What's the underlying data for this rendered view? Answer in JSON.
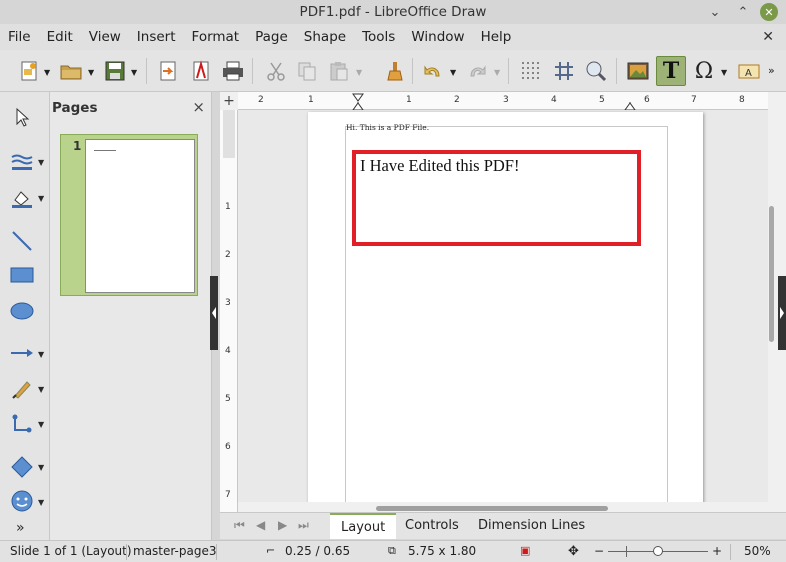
{
  "window": {
    "title": "PDF1.pdf - LibreOffice Draw"
  },
  "menu": [
    "File",
    "Edit",
    "View",
    "Insert",
    "Format",
    "Page",
    "Shape",
    "Tools",
    "Window",
    "Help"
  ],
  "toolbar": {
    "icons": [
      "new-document-icon",
      "open-folder-icon",
      "save-icon",
      "export-icon",
      "export-pdf-icon",
      "print-icon",
      "cut-icon",
      "copy-icon",
      "paste-icon",
      "clone-formatting-icon",
      "undo-icon",
      "redo-icon",
      "grid-icon",
      "helplines-icon",
      "zoom-icon",
      "image-icon",
      "text-icon",
      "special-character-icon",
      "fontwork-icon"
    ]
  },
  "pages_panel": {
    "title": "Pages",
    "close": "×",
    "thumbnails": [
      {
        "number": "1"
      }
    ]
  },
  "ruler": {
    "h_ticks": [
      "2",
      "1",
      "1",
      "2",
      "3",
      "4",
      "5",
      "6",
      "7",
      "8"
    ],
    "v_ticks": [
      "1",
      "2",
      "3",
      "4",
      "5",
      "6",
      "7"
    ]
  },
  "document": {
    "small_text": "Hi. This is a PDF File.",
    "edited_text": "I Have Edited this PDF!",
    "highlight_color": "#e01f26"
  },
  "tabs": {
    "items": [
      "Layout",
      "Controls",
      "Dimension Lines"
    ],
    "active": "Layout"
  },
  "status": {
    "slide": "Slide 1 of 1 (Layout)",
    "master": "master-page3",
    "position": "0.25 / 0.65",
    "size": "5.75 x 1.80",
    "zoom": "50%"
  },
  "colors": {
    "accent": "#8aab57",
    "active_tool": "#9cb277"
  }
}
